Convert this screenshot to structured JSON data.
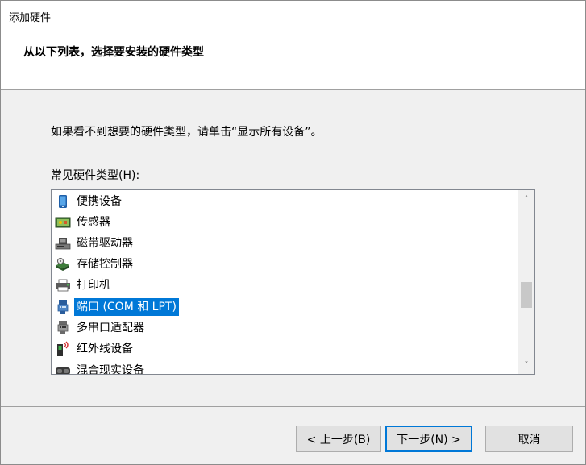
{
  "window": {
    "title": "添加硬件"
  },
  "header": {
    "heading": "从以下列表，选择要安装的硬件类型"
  },
  "main": {
    "instruction": "如果看不到想要的硬件类型，请单击“显示所有设备”。",
    "list_label": "常见硬件类型(H):",
    "items": [
      {
        "label": "便携设备",
        "icon": "portable-device-icon",
        "selected": false
      },
      {
        "label": "传感器",
        "icon": "sensor-icon",
        "selected": false
      },
      {
        "label": "磁带驱动器",
        "icon": "tape-drive-icon",
        "selected": false
      },
      {
        "label": "存储控制器",
        "icon": "storage-controller-icon",
        "selected": false
      },
      {
        "label": "打印机",
        "icon": "printer-icon",
        "selected": false
      },
      {
        "label": "端口 (COM 和 LPT)",
        "icon": "port-icon",
        "selected": true
      },
      {
        "label": "多串口适配器",
        "icon": "multiport-serial-icon",
        "selected": false
      },
      {
        "label": "红外线设备",
        "icon": "infrared-device-icon",
        "selected": false
      },
      {
        "label": "混合现实设备",
        "icon": "mixed-reality-icon",
        "selected": false
      }
    ],
    "scrollbar": {
      "up_arrow": "˄",
      "down_arrow": "˅"
    }
  },
  "footer": {
    "back_label": "< 上一步(B)",
    "next_label": "下一步(N) >",
    "cancel_label": "取消"
  },
  "colors": {
    "selection": "#0078d7",
    "background": "#f0f0f0",
    "header_bg": "#ffffff"
  }
}
